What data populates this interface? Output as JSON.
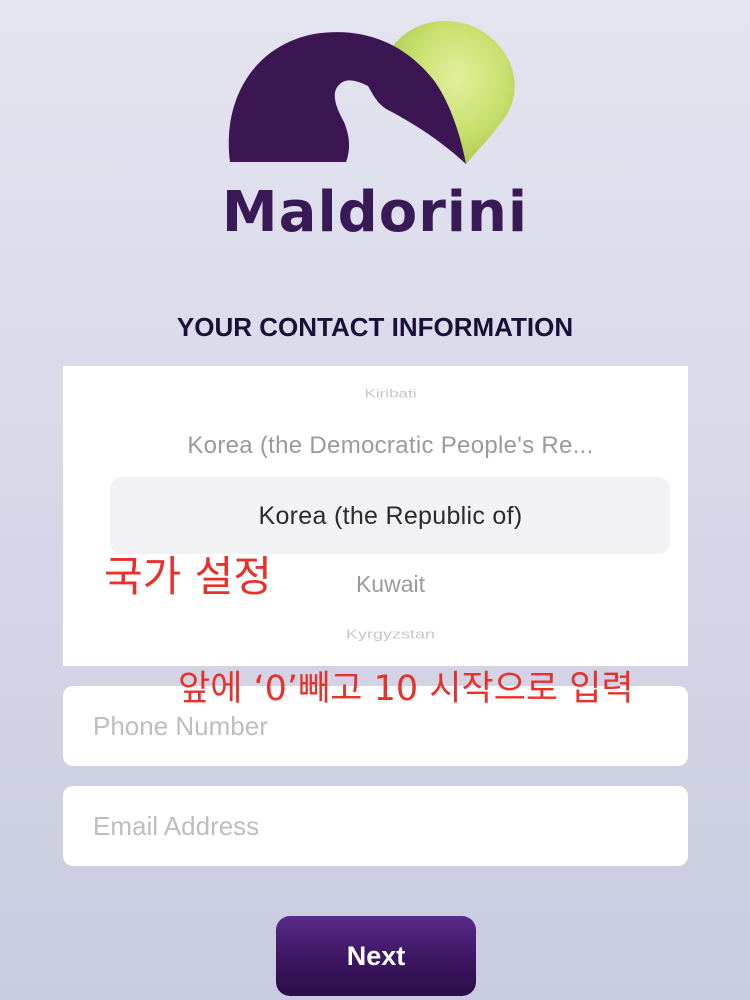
{
  "brand": {
    "name": "Maldorini",
    "logo": "maldorini-logo",
    "colors": {
      "primary_purple": "#3a1a56",
      "accent_green": "#c8e06e"
    }
  },
  "form": {
    "title": "YOUR CONTACT INFORMATION",
    "country_picker": {
      "items": [
        "Kiribati",
        "Korea (the Democratic People's Re...",
        "Korea (the Republic of)",
        "Kuwait",
        "Kyrgyzstan"
      ],
      "selected": "Korea (the Republic of)"
    },
    "phone": {
      "placeholder": "Phone Number",
      "value": ""
    },
    "email": {
      "placeholder": "Email Address",
      "value": ""
    },
    "next_label": "Next"
  },
  "annotations": {
    "country_note": "국가 설정",
    "phone_note": "앞에 ‘0’빼고 10 시작으로 입력",
    "color": "#e8312a"
  }
}
